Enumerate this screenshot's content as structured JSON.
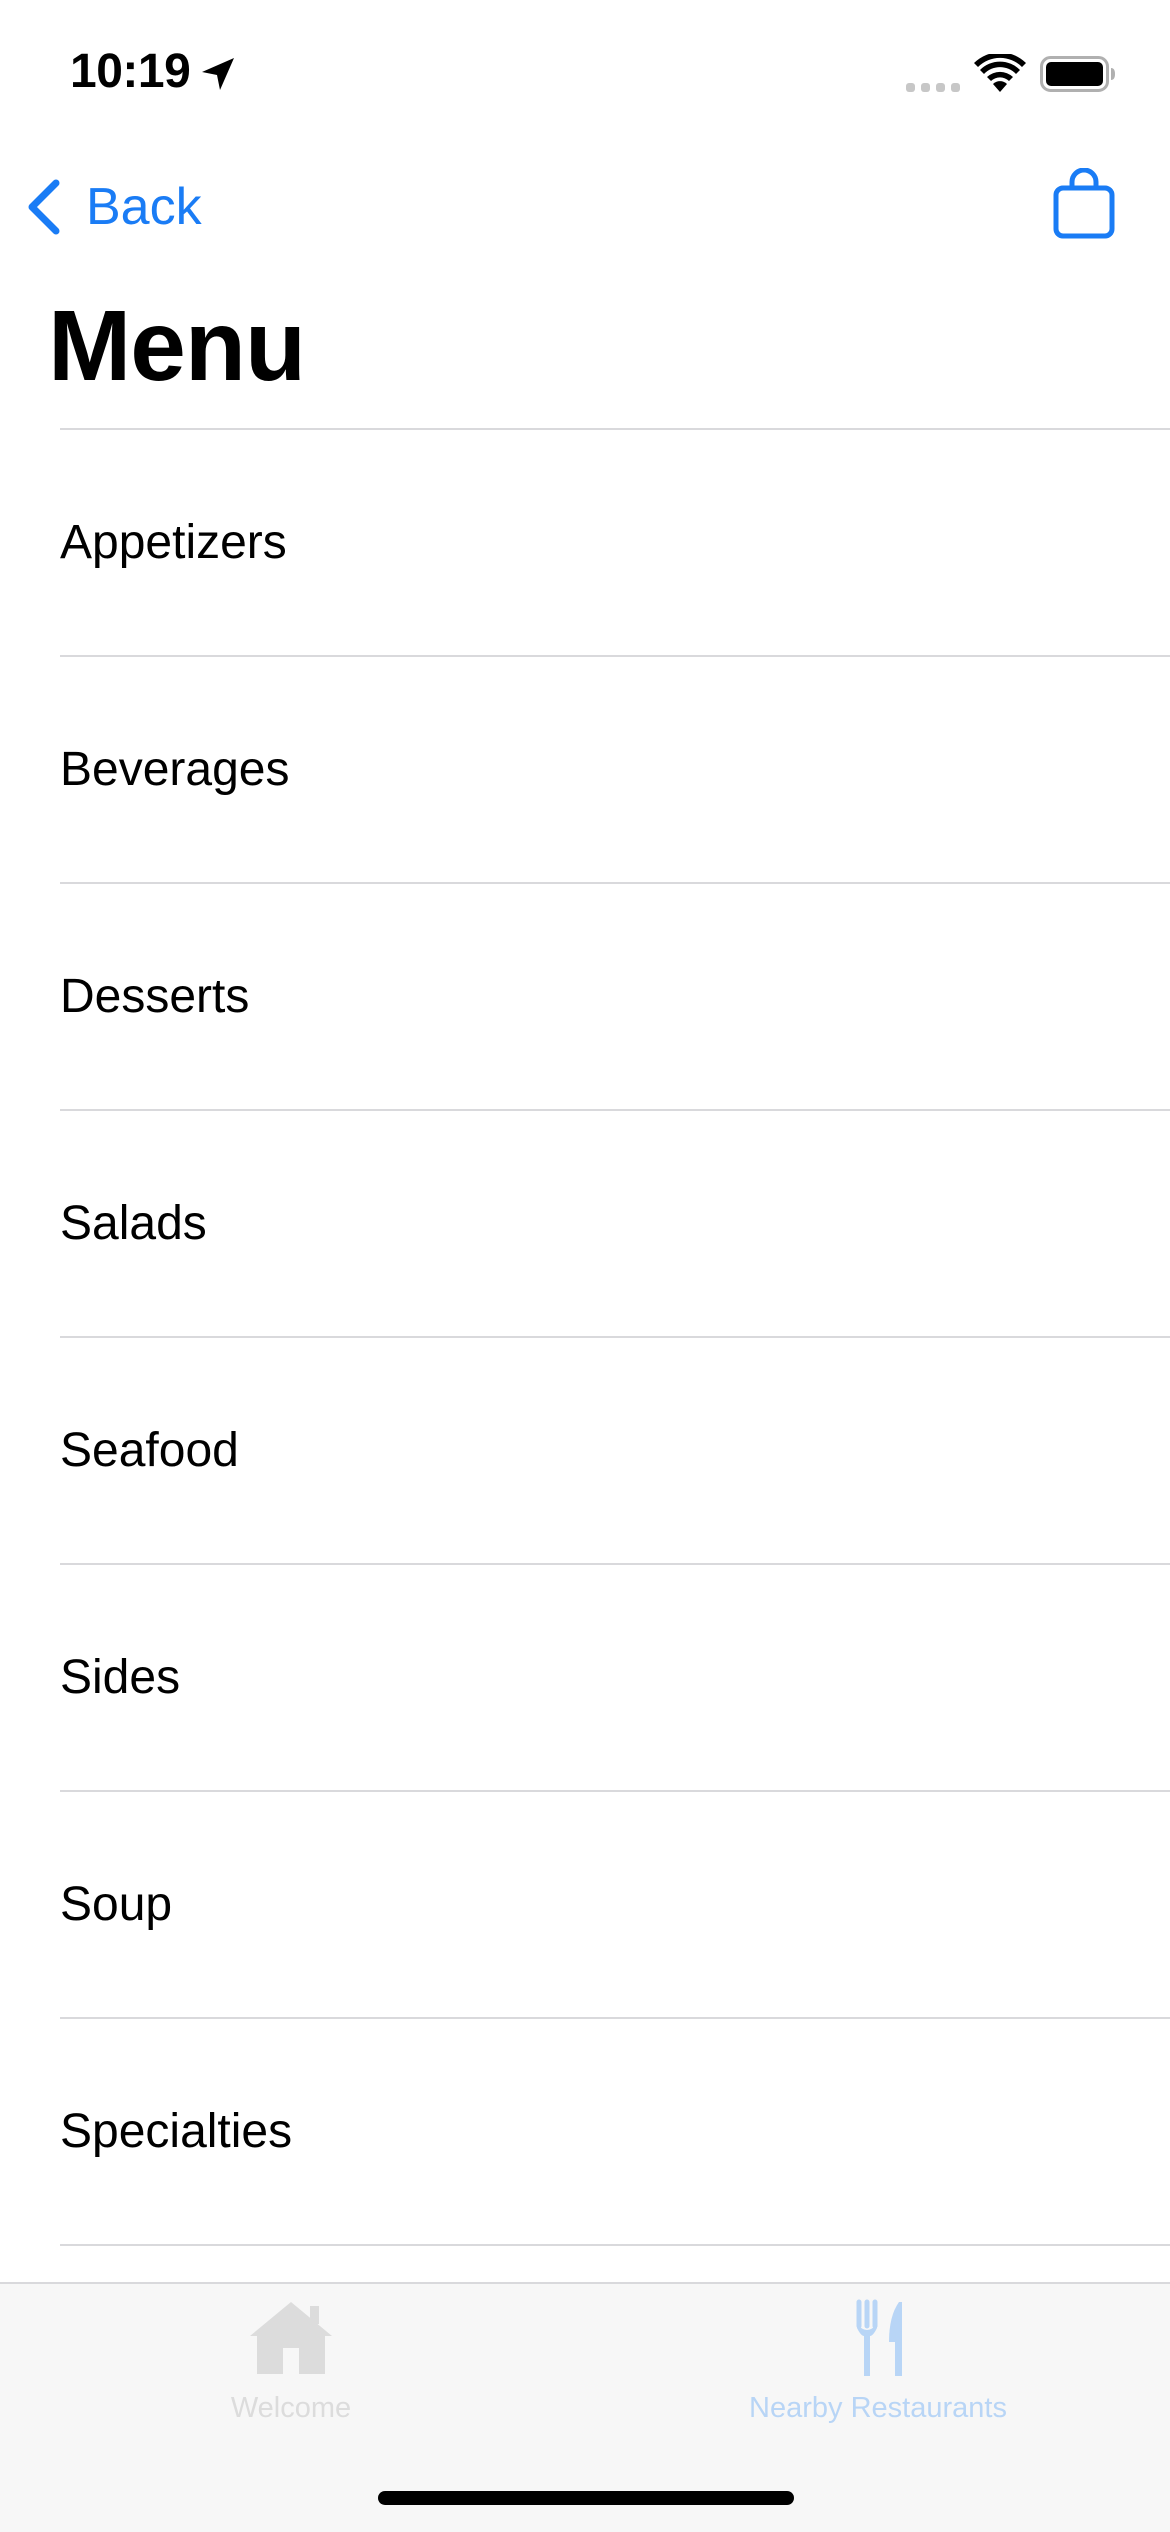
{
  "status_bar": {
    "time": "10:19",
    "icons": [
      "location-arrow-icon",
      "cellular-signal-icon",
      "wifi-icon",
      "battery-icon"
    ]
  },
  "nav": {
    "back_label": "Back",
    "back_icon": "chevron-left-icon",
    "cart_icon": "shopping-bag-icon",
    "tint_color": "#1a7cf5"
  },
  "page": {
    "title": "Menu"
  },
  "menu": {
    "items": [
      {
        "label": "Appetizers"
      },
      {
        "label": "Beverages"
      },
      {
        "label": "Desserts"
      },
      {
        "label": "Salads"
      },
      {
        "label": "Seafood"
      },
      {
        "label": "Sides"
      },
      {
        "label": "Soup"
      },
      {
        "label": "Specialties"
      }
    ]
  },
  "tab_bar": {
    "tabs": [
      {
        "label": "Welcome",
        "icon": "house-icon",
        "color": "#dcdcdc"
      },
      {
        "label": "Nearby Restaurants",
        "icon": "fork-knife-icon",
        "color": "#b8d5f6"
      }
    ]
  }
}
